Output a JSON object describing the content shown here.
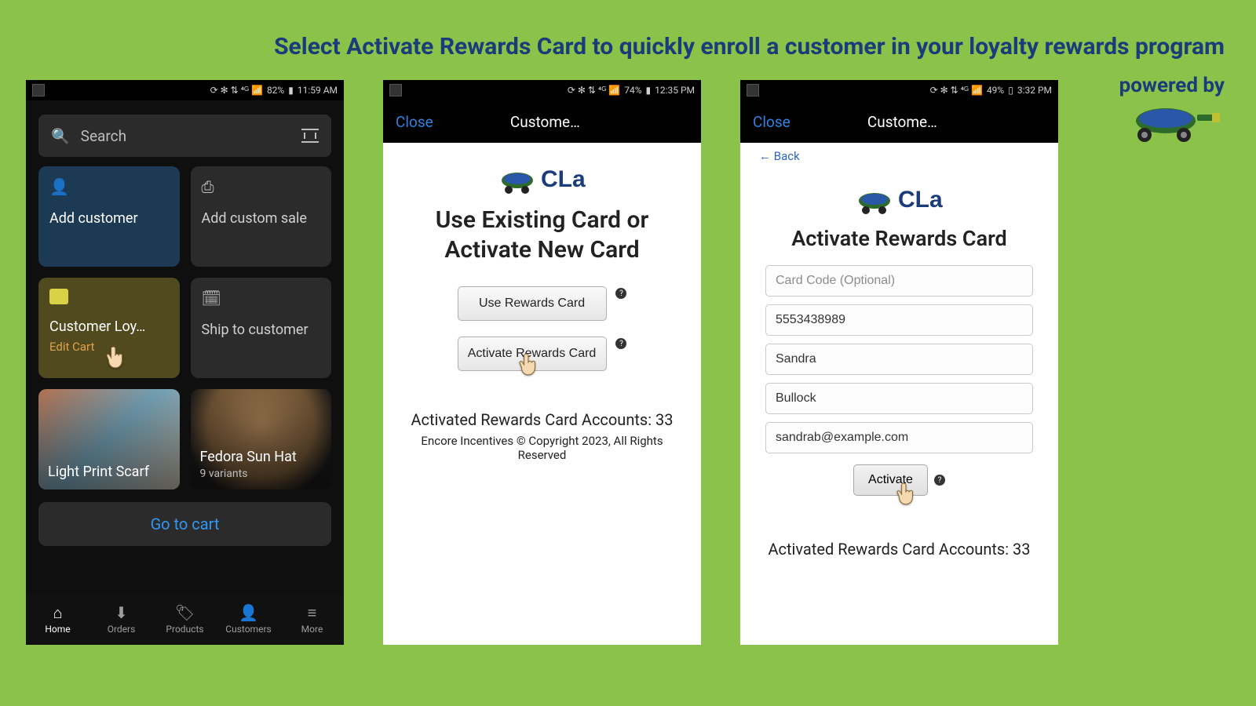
{
  "headline": "Select Activate Rewards Card to quickly enroll a customer in your loyalty rewards program",
  "powered_by": "powered by",
  "phone1": {
    "status": {
      "battery": "82%",
      "time": "11:59 AM"
    },
    "search_placeholder": "Search",
    "tiles": {
      "add_customer": "Add customer",
      "add_custom_sale": "Add custom sale",
      "loyalty_title": "Customer Loy…",
      "loyalty_sub": "Edit Cart",
      "ship_to": "Ship to customer"
    },
    "products": {
      "scarf": "Light Print Scarf",
      "hat": "Fedora Sun Hat",
      "hat_variants": "9 variants"
    },
    "go_to_cart": "Go to cart",
    "nav": {
      "home": "Home",
      "orders": "Orders",
      "products": "Products",
      "customers": "Customers",
      "more": "More"
    }
  },
  "phone2": {
    "status": {
      "battery": "74%",
      "time": "12:35 PM"
    },
    "close": "Close",
    "nav_title": "Custome…",
    "heading_line1": "Use Existing Card or",
    "heading_line2": "Activate New Card",
    "use_btn": "Use Rewards Card",
    "activate_btn": "Activate Rewards Card",
    "accounts": "Activated Rewards Card Accounts: 33",
    "copyright": "Encore Incentives © Copyright 2023, All Rights Reserved"
  },
  "phone3": {
    "status": {
      "battery": "49%",
      "time": "3:32 PM"
    },
    "close": "Close",
    "nav_title": "Custome…",
    "back": "← Back",
    "heading": "Activate Rewards Card",
    "card_code_placeholder": "Card Code (Optional)",
    "phone": "5553438989",
    "first": "Sandra",
    "last": "Bullock",
    "email": "sandrab@example.com",
    "activate": "Activate",
    "accounts": "Activated Rewards Card Accounts: 33"
  }
}
